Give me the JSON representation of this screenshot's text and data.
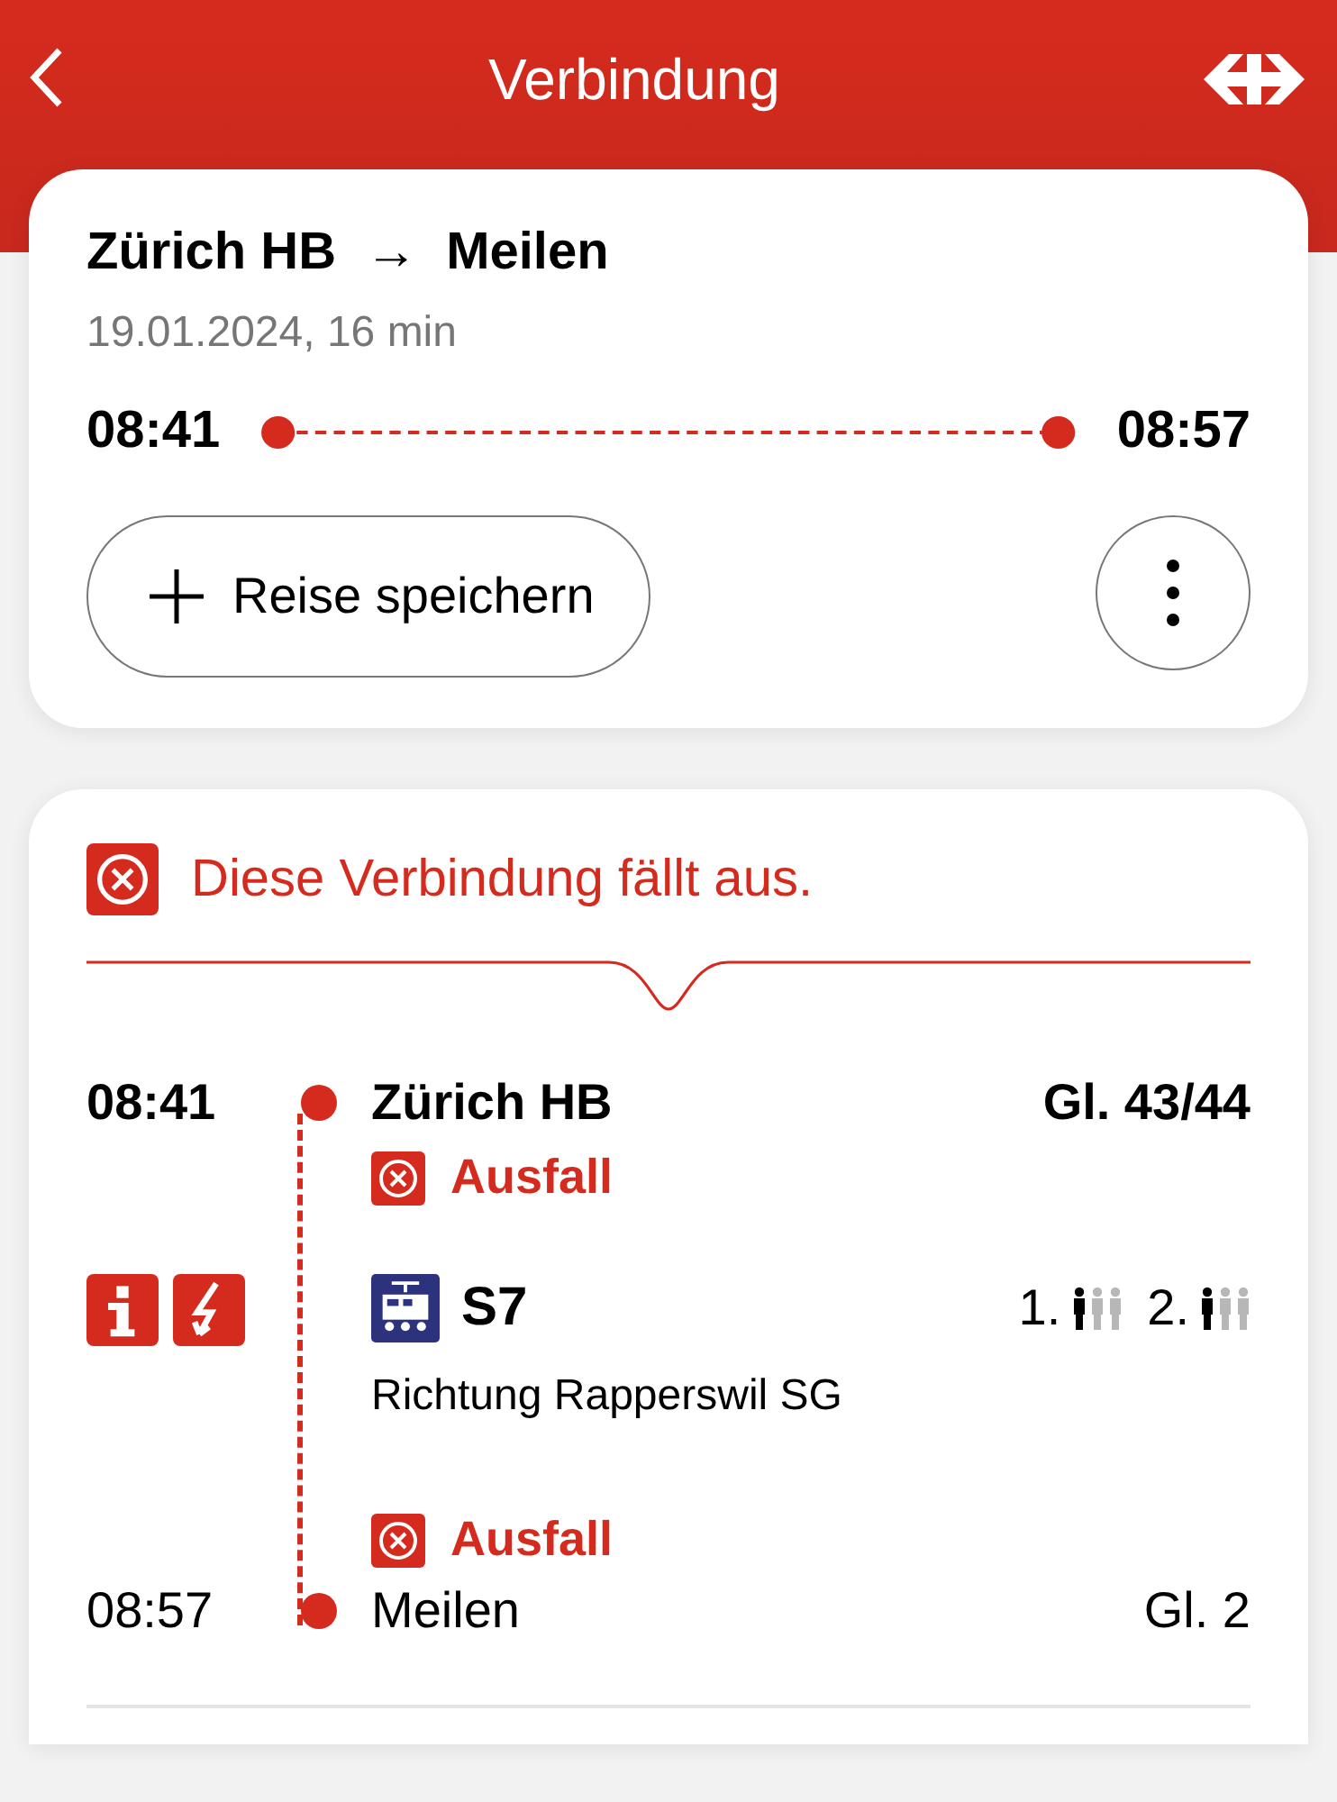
{
  "header": {
    "title": "Verbindung"
  },
  "summary": {
    "from": "Zürich HB",
    "arrow": "→",
    "to": "Meilen",
    "meta": "19.01.2024, 16 min",
    "departure": "08:41",
    "arrival": "08:57",
    "save_button": "Reise speichern"
  },
  "alert": {
    "message": "Diese Verbindung fällt aus."
  },
  "stops": [
    {
      "kind": "departure",
      "time": "08:41",
      "name": "Zürich HB",
      "platform": "Gl. 43/44",
      "status": "Ausfall"
    },
    {
      "kind": "arrival",
      "time": "08:57",
      "name": "Meilen",
      "platform": "Gl. 2",
      "status": "Ausfall"
    }
  ],
  "journey": {
    "line": "S7",
    "direction": "Richtung Rapperswil SG",
    "classes": [
      {
        "label": "1.",
        "figures": [
          {
            "filled": true
          },
          {
            "filled": false
          },
          {
            "filled": false
          }
        ]
      },
      {
        "label": "2.",
        "figures": [
          {
            "filled": true
          },
          {
            "filled": false
          },
          {
            "filled": false
          }
        ]
      }
    ]
  }
}
